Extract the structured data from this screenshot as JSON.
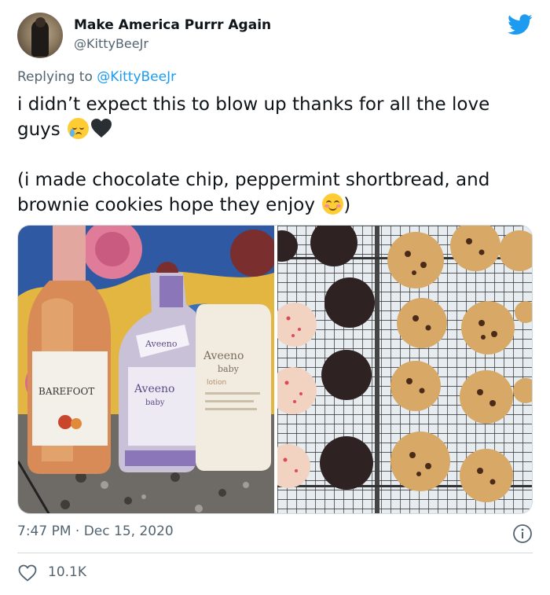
{
  "author": {
    "display_name": "Make America Purrr Again",
    "handle": "@KittyBeeJr"
  },
  "reply": {
    "prefix": "Replying to ",
    "mention": "@KittyBeeJr"
  },
  "tweet": {
    "line1": "i didn’t expect this to blow up thanks for all the love guys",
    "line2": "(i made chocolate chip, peppermint shortbread, and brownie cookies hope they enjoy",
    "line2_close": ")"
  },
  "media": {
    "left_photo": "photo-wine-bottle-and-aveeno-baby-products",
    "right_photo": "photo-cookies-on-cooling-racks"
  },
  "meta": {
    "time": "7:47 PM",
    "separator": " · ",
    "date": "Dec 15, 2020"
  },
  "engagement": {
    "likes": "10.1K"
  },
  "icons": {
    "brand": "twitter-bird-icon",
    "info": "info-icon",
    "like": "heart-outline-icon"
  },
  "colors": {
    "brand_blue": "#1d9bf0",
    "muted": "#536471",
    "text": "#0f1419"
  }
}
